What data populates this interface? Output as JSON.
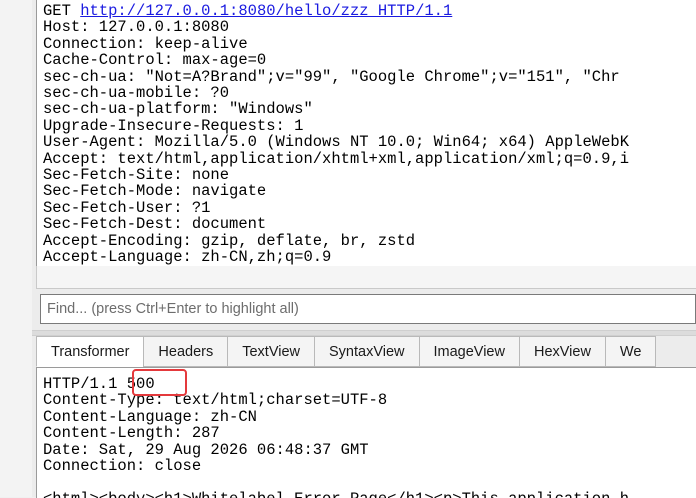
{
  "request": {
    "method": "GET",
    "url": "http://127.0.0.1:8080/hello/zzz HTTP/1.1",
    "lines": [
      "Host: 127.0.0.1:8080",
      "Connection: keep-alive",
      "Cache-Control: max-age=0",
      "sec-ch-ua: \"Not=A?Brand\";v=\"99\", \"Google Chrome\";v=\"151\", \"Chr",
      "sec-ch-ua-mobile: ?0",
      "sec-ch-ua-platform: \"Windows\"",
      "Upgrade-Insecure-Requests: 1",
      "User-Agent: Mozilla/5.0 (Windows NT 10.0; Win64; x64) AppleWebK",
      "Accept: text/html,application/xhtml+xml,application/xml;q=0.9,i",
      "Sec-Fetch-Site: none",
      "Sec-Fetch-Mode: navigate",
      "Sec-Fetch-User: ?1",
      "Sec-Fetch-Dest: document",
      "Accept-Encoding: gzip, deflate, br, zstd",
      "Accept-Language: zh-CN,zh;q=0.9"
    ]
  },
  "find": {
    "placeholder": "Find... (press Ctrl+Enter to highlight all)"
  },
  "tabs": [
    {
      "label": "Transformer",
      "active": true
    },
    {
      "label": "Headers",
      "active": false
    },
    {
      "label": "TextView",
      "active": false
    },
    {
      "label": "SyntaxView",
      "active": false
    },
    {
      "label": "ImageView",
      "active": false
    },
    {
      "label": "HexView",
      "active": false
    },
    {
      "label": "We",
      "active": false
    }
  ],
  "response": {
    "protocol": "HTTP/1.1",
    "status": "500",
    "lines": [
      "Content-Type: text/html;charset=UTF-8",
      "Content-Language: zh-CN",
      "Content-Length: 287",
      "Date: Sat, 29 Aug 2026 06:48:37 GMT",
      "Connection: close",
      "",
      "<html><body><h1>Whitelabel Error Page</h1><p>This application h"
    ]
  },
  "colors": {
    "link": "#1a1ae0",
    "highlight": "#e4393c"
  }
}
